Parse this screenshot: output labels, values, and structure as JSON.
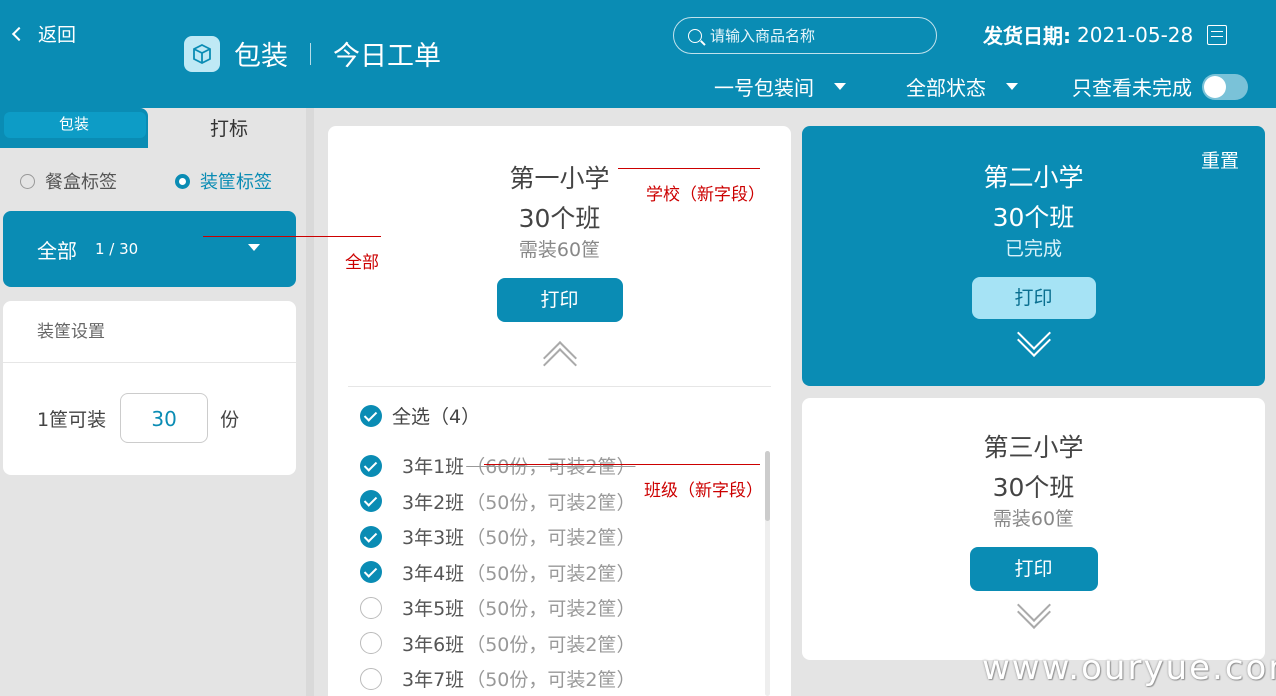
{
  "header": {
    "back_label": "返回",
    "title": "包装",
    "subtitle": "今日工单",
    "search_placeholder": "请输入商品名称",
    "ship_date_label": "发货日期:",
    "ship_date_value": "2021-05-28",
    "room_dropdown": "一号包装间",
    "status_dropdown": "全部状态",
    "toggle_label": "只查看未完成",
    "toggle_on": false,
    "accent_color": "#0a8cb4",
    "icons": [
      "chevron-left-icon",
      "box-icon",
      "search-icon",
      "calendar-icon",
      "caret-down-icon"
    ]
  },
  "left": {
    "tabs": [
      {
        "label": "包装",
        "active": true
      },
      {
        "label": "打标",
        "active": false
      }
    ],
    "radios": [
      {
        "label": "餐盒标签",
        "selected": false
      },
      {
        "label": "装筐标签",
        "selected": true
      }
    ],
    "all_bar": {
      "label": "全部",
      "count": "1 / 30"
    },
    "setting": {
      "title": "装筐设置",
      "prefix": "1筐可装",
      "value": "30",
      "suffix": "份"
    }
  },
  "cards": [
    {
      "name": "第一小学",
      "classes": "30个班",
      "need": "需装60筐",
      "print_label": "打印",
      "select_all_label": "全选（4）",
      "class_items": [
        {
          "name": "3年1班",
          "info": "（60份，可装2筐）",
          "checked": true
        },
        {
          "name": "3年2班",
          "info": "（50份，可装2筐）",
          "checked": true
        },
        {
          "name": "3年3班",
          "info": "（50份，可装2筐）",
          "checked": true
        },
        {
          "name": "3年4班",
          "info": "（50份，可装2筐）",
          "checked": true
        },
        {
          "name": "3年5班",
          "info": "（50份，可装2筐）",
          "checked": false
        },
        {
          "name": "3年6班",
          "info": "（50份，可装2筐）",
          "checked": false
        },
        {
          "name": "3年7班",
          "info": "（50份，可装2筐）",
          "checked": false
        }
      ]
    },
    {
      "name": "第二小学",
      "classes": "30个班",
      "need": "已完成",
      "print_label": "打印",
      "reset_label": "重置"
    },
    {
      "name": "第三小学",
      "classes": "30个班",
      "need": "需装60筐",
      "print_label": "打印"
    }
  ],
  "annotations": {
    "all": "全部",
    "school": "学校（新字段）",
    "class": "班级（新字段）"
  },
  "watermark": "www.ouryue.com"
}
